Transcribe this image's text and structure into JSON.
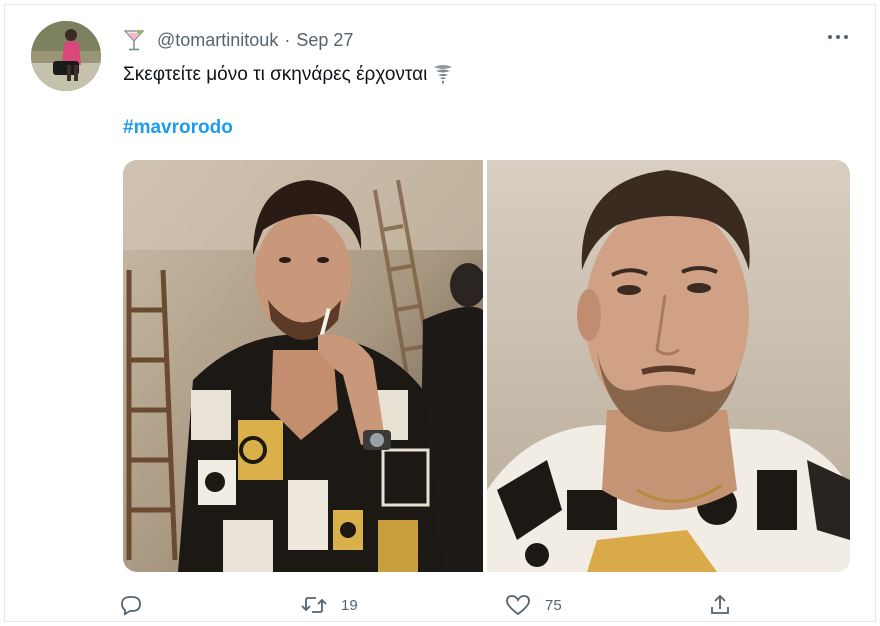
{
  "tweet": {
    "handle": "@tomartinitouk",
    "separator": "·",
    "date": "Sep 27",
    "text": "Σκεφτείτε μόνο τι σκηνάρες έρχονται",
    "hashtag": "#mavrorodo",
    "handle_emoji_icon": "cocktail-glass-icon",
    "text_emoji_icon": "tornado-icon"
  },
  "media": {
    "photos": [
      "photo-man-smoking",
      "photo-man-portrait"
    ]
  },
  "actions": {
    "reply_count": "",
    "retweet_count": "19",
    "like_count": "75",
    "share_count": ""
  },
  "colors": {
    "link": "#1d9bf0",
    "muted": "#536471",
    "text": "#0f1419"
  }
}
